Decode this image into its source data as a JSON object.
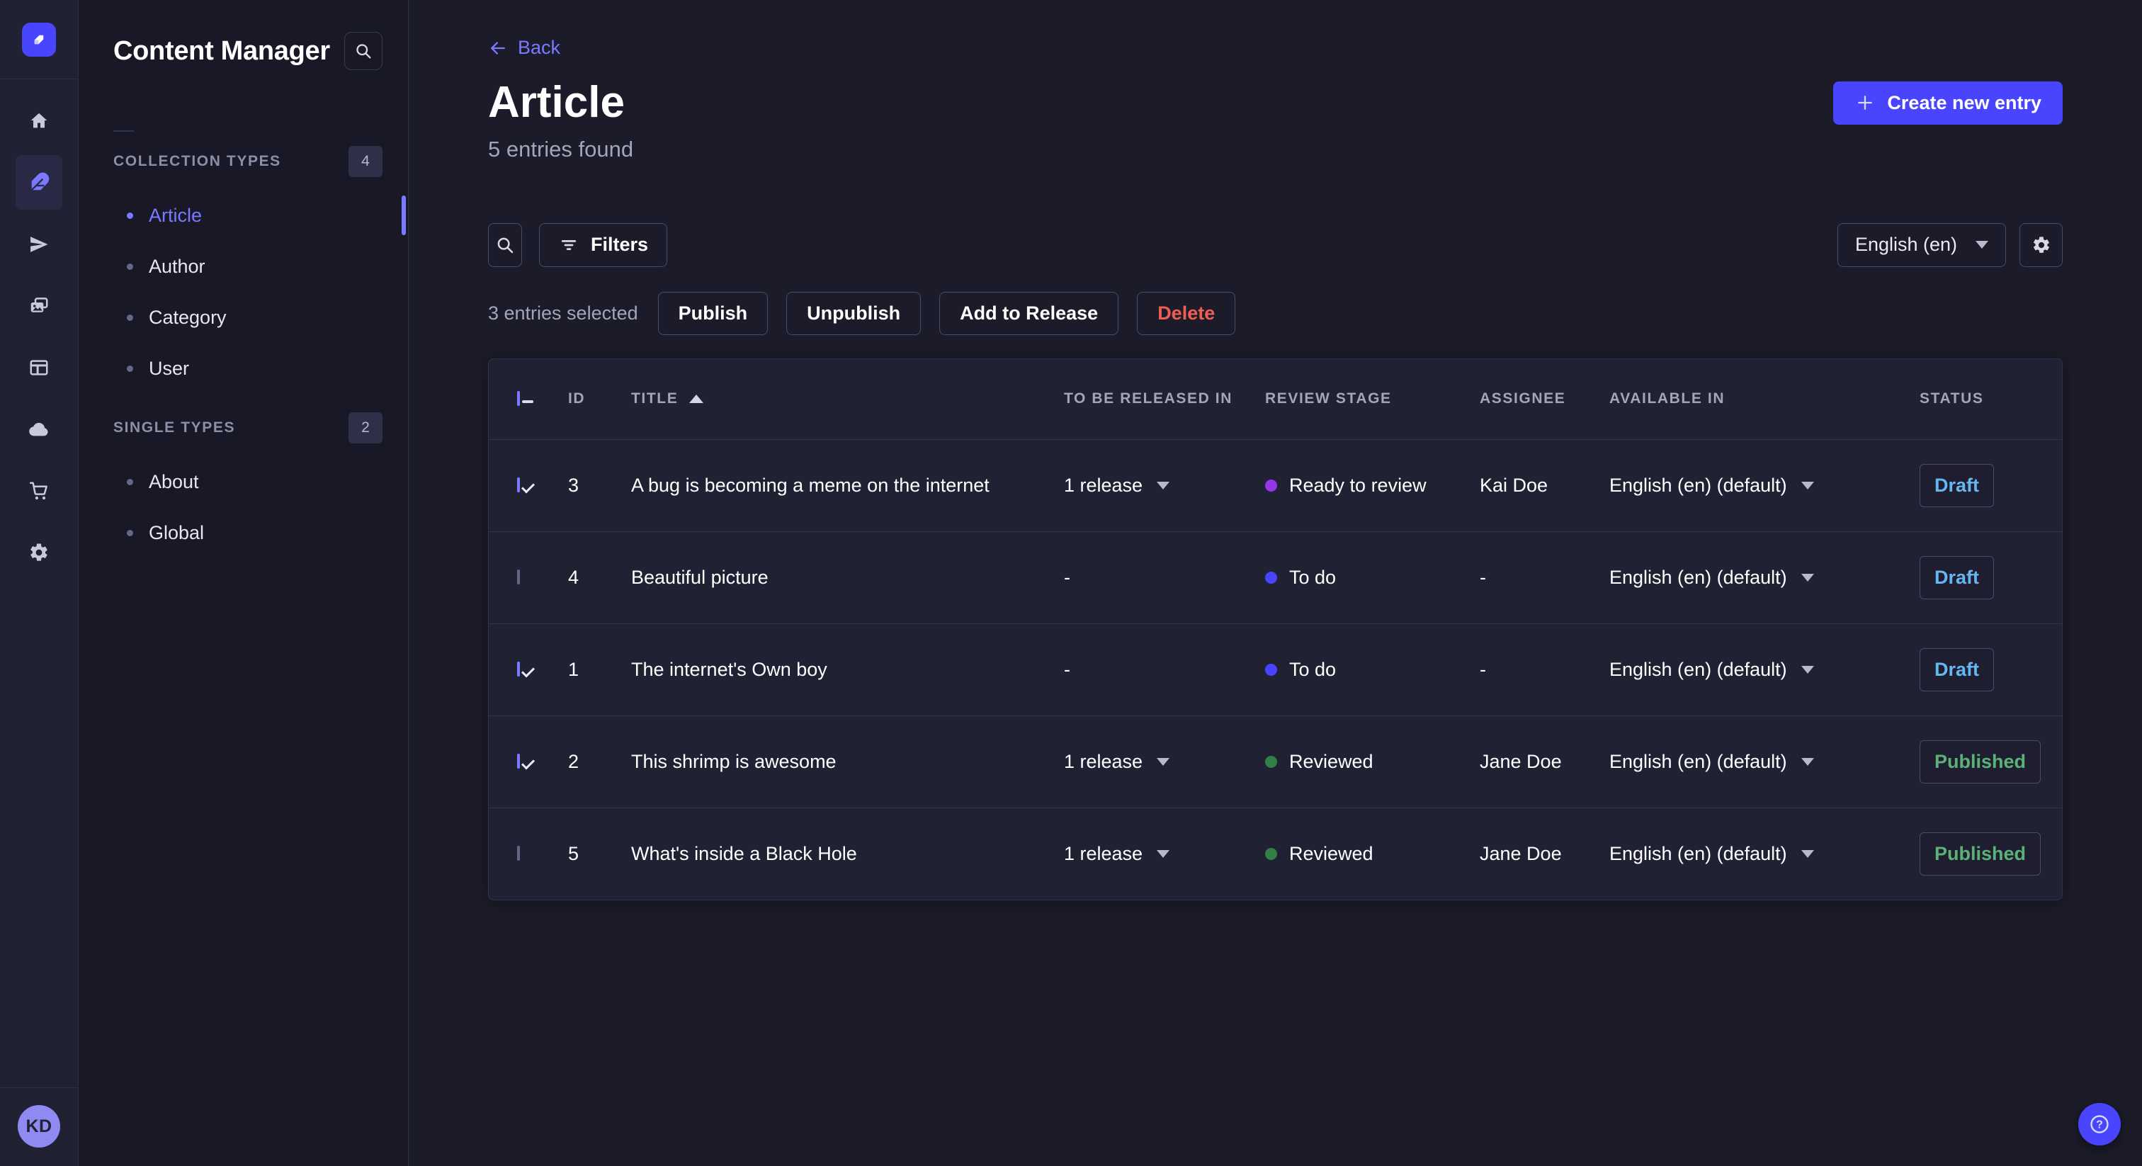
{
  "rail": {
    "logo_icon": "strapi-logo",
    "items": [
      {
        "icon": "home-icon",
        "active": false
      },
      {
        "icon": "content-manager-feather-icon",
        "active": true
      },
      {
        "icon": "releases-paper-plane-icon",
        "active": false
      },
      {
        "icon": "media-library-icon",
        "active": false
      },
      {
        "icon": "content-type-builder-icon",
        "active": false
      },
      {
        "icon": "deploy-cloud-icon",
        "active": false
      },
      {
        "icon": "marketplace-cart-icon",
        "active": false
      },
      {
        "icon": "settings-gear-icon",
        "active": false
      }
    ],
    "avatar_initials": "KD"
  },
  "sidebar": {
    "title": "Content Manager",
    "search_icon": "search-icon",
    "sections": [
      {
        "label": "COLLECTION TYPES",
        "count": "4",
        "items": [
          {
            "label": "Article",
            "active": true
          },
          {
            "label": "Author",
            "active": false
          },
          {
            "label": "Category",
            "active": false
          },
          {
            "label": "User",
            "active": false
          }
        ]
      },
      {
        "label": "SINGLE TYPES",
        "count": "2",
        "items": [
          {
            "label": "About",
            "active": false
          },
          {
            "label": "Global",
            "active": false
          }
        ]
      }
    ]
  },
  "header": {
    "back_label": "Back",
    "title": "Article",
    "subtitle": "5 entries found",
    "create_button": "Create new entry"
  },
  "toolbar": {
    "search_icon": "search-icon",
    "filters_label": "Filters",
    "locale_selected": "English (en)",
    "settings_icon": "gear-icon"
  },
  "selection": {
    "label": "3 entries selected",
    "publish": "Publish",
    "unpublish": "Unpublish",
    "add_to_release": "Add to Release",
    "delete": "Delete"
  },
  "table": {
    "columns": [
      "ID",
      "TITLE",
      "TO BE RELEASED IN",
      "REVIEW STAGE",
      "ASSIGNEE",
      "AVAILABLE IN",
      "STATUS"
    ],
    "sorted_column": "TITLE",
    "sort_direction": "asc",
    "rows": [
      {
        "selected": true,
        "id": "3",
        "title": "A bug is becoming a meme on the internet",
        "to_be_released_in": "1 release",
        "review_stage": "Ready to review",
        "stage_color": "#9736e8",
        "assignee": "Kai Doe",
        "available_in": "English (en) (default)",
        "status": "Draft"
      },
      {
        "selected": false,
        "id": "4",
        "title": "Beautiful picture",
        "to_be_released_in": "-",
        "review_stage": "To do",
        "stage_color": "#4945ff",
        "assignee": "-",
        "available_in": "English (en) (default)",
        "status": "Draft"
      },
      {
        "selected": true,
        "id": "1",
        "title": "The internet's Own boy",
        "to_be_released_in": "-",
        "review_stage": "To do",
        "stage_color": "#4945ff",
        "assignee": "-",
        "available_in": "English (en) (default)",
        "status": "Draft"
      },
      {
        "selected": true,
        "id": "2",
        "title": "This shrimp is awesome",
        "to_be_released_in": "1 release",
        "review_stage": "Reviewed",
        "stage_color": "#328048",
        "assignee": "Jane Doe",
        "available_in": "English (en) (default)",
        "status": "Published"
      },
      {
        "selected": false,
        "id": "5",
        "title": "What's inside a Black Hole",
        "to_be_released_in": "1 release",
        "review_stage": "Reviewed",
        "stage_color": "#328048",
        "assignee": "Jane Doe",
        "available_in": "English (en) (default)",
        "status": "Published"
      }
    ]
  },
  "help": {
    "icon": "question-mark-icon",
    "glyph": "?"
  },
  "colors": {
    "primary": "#4945ff",
    "accent": "#7b79ff",
    "danger": "#ee5e52",
    "draft_status": "#66b7f1",
    "published_status": "#5cb176",
    "surface": "#212134",
    "background": "#181826"
  }
}
